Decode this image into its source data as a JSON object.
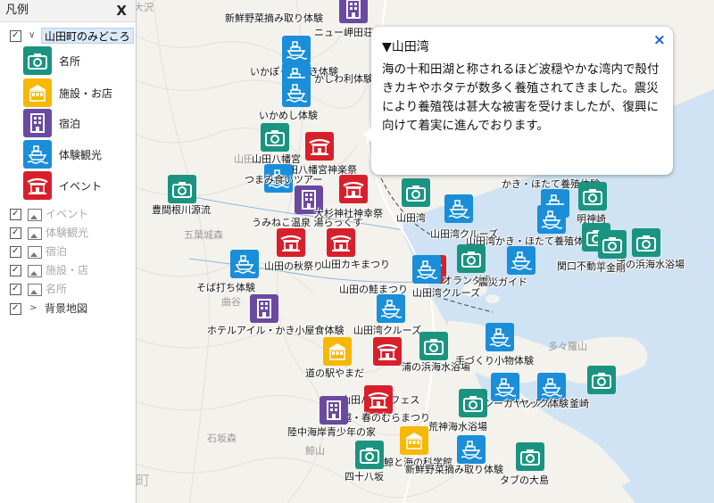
{
  "legend": {
    "title": "凡例",
    "close": "X",
    "layer_name": "山田町のみどころ",
    "categories": [
      {
        "label": "名所",
        "color": "#1a9480",
        "icon": "camera-icon"
      },
      {
        "label": "施設・お店",
        "color": "#f6b800",
        "icon": "building-icon"
      },
      {
        "label": "宿泊",
        "color": "#6a4aa0",
        "icon": "hotel-icon"
      },
      {
        "label": "体験観光",
        "color": "#1a8ed8",
        "icon": "boat-icon"
      },
      {
        "label": "イベント",
        "color": "#d8202c",
        "icon": "shrine-icon"
      }
    ],
    "sublayers": [
      "イベント",
      "体験観光",
      "宿泊",
      "施設・店",
      "名所"
    ],
    "base_map": "背景地図"
  },
  "map": {
    "place_names": [
      "新鮮野菜摘み取り体験",
      "ニュー岬田荘",
      "豊間根川源流",
      "五葉城森",
      "山田八幡宮",
      "石坂森",
      "大沢",
      "鯨山",
      "大槌町",
      "多々羅山",
      "曲谷",
      "山田"
    ],
    "pois": [
      {
        "label": "新鮮野菜摘み取り体験",
        "type": "宿泊"
      },
      {
        "label": "ニュー岬田荘",
        "type": "宿泊"
      },
      {
        "label": "いかぽっぽ焼き体験",
        "type": "体験観光"
      },
      {
        "label": "かしわ利体験",
        "type": "体験観光"
      },
      {
        "label": "いかめし体験",
        "type": "体験観光"
      },
      {
        "label": "山田八幡宮",
        "type": "名所"
      },
      {
        "label": "山田八幡宮神楽祭",
        "type": "イベント"
      },
      {
        "label": "豊間根川源流",
        "type": "名所"
      },
      {
        "label": "つまみ食いツアー",
        "type": "体験観光"
      },
      {
        "label": "うみねこ温泉 湯らっくす",
        "type": "宿泊"
      },
      {
        "label": "大杉神社神幸祭",
        "type": "イベント"
      },
      {
        "label": "山田湾",
        "type": "名所"
      },
      {
        "label": "山田湾クルーズ",
        "type": "体験観光"
      },
      {
        "label": "かき・ほたて養殖体験",
        "type": "体験観光"
      },
      {
        "label": "明神崎",
        "type": "名所"
      },
      {
        "label": "山田湾かき・ほたて養殖体験",
        "type": "体験観光"
      },
      {
        "label": "関口不動尊",
        "type": "名所"
      },
      {
        "label": "浦の浜海水浴場",
        "type": "名所"
      },
      {
        "label": "平金剛",
        "type": "名所"
      },
      {
        "label": "山田の秋祭り",
        "type": "イベント"
      },
      {
        "label": "山田カキまつり",
        "type": "イベント"
      },
      {
        "label": "そば打ち体験",
        "type": "体験観光"
      },
      {
        "label": "山田の鮭まつり",
        "type": "イベント"
      },
      {
        "label": "山田湾クルーズ",
        "type": "体験観光"
      },
      {
        "label": "オランダ島",
        "type": "名所"
      },
      {
        "label": "震災ガイド",
        "type": "体験観光"
      },
      {
        "label": "ホテルアイル・かき小屋食体験",
        "type": "宿泊"
      },
      {
        "label": "山田湾クルーズ",
        "type": "体験観光"
      },
      {
        "label": "道の駅やまだ",
        "type": "施設・お店"
      },
      {
        "label": "山田パドルフェス",
        "type": "イベント"
      },
      {
        "label": "浦の浜海水浴場",
        "type": "名所"
      },
      {
        "label": "手づくり小物体験",
        "type": "体験観光"
      },
      {
        "label": "シーカヤック体験",
        "type": "体験観光"
      },
      {
        "label": "ヤック体験",
        "type": "体験観光"
      },
      {
        "label": "釜崎",
        "type": "名所"
      },
      {
        "label": "船越・春のむらまつり",
        "type": "イベント"
      },
      {
        "label": "陸中海岸青少年の家",
        "type": "宿泊"
      },
      {
        "label": "荒神海水浴場",
        "type": "名所"
      },
      {
        "label": "鯨と海の科学館",
        "type": "施設・お店"
      },
      {
        "label": "四十八坂",
        "type": "名所"
      },
      {
        "label": "新鮮野菜摘み取り体験",
        "type": "体験観光"
      },
      {
        "label": "タブの大島",
        "type": "名所"
      }
    ]
  },
  "popup": {
    "title": "▼山田湾",
    "body": "海の十和田湖と称されるほど波穏やかな湾内で殻付きカキやホタテが数多く養殖されてきました。震災により養殖筏は甚大な被害を受けましたが、復興に向けて着実に進んでおります。",
    "close": "×"
  }
}
